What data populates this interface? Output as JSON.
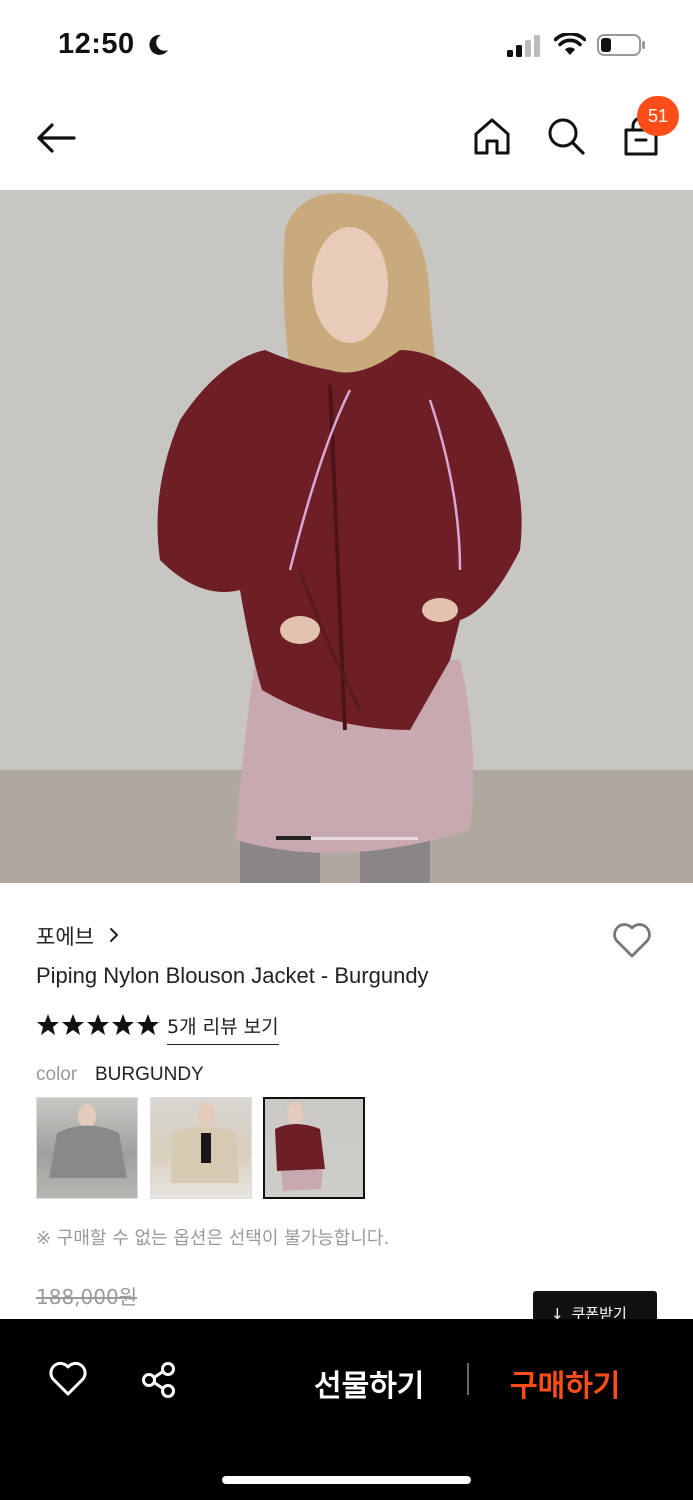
{
  "status_bar": {
    "time": "12:50",
    "icons": [
      "moon-icon",
      "signal-icon",
      "wifi-icon",
      "battery-icon"
    ]
  },
  "nav": {
    "icons": [
      "back-arrow-icon",
      "home-icon",
      "search-icon",
      "shopping-bag-icon"
    ],
    "cart_count": "51",
    "badge_color": "#ff4d1a"
  },
  "product": {
    "image_pager": {
      "total": 4,
      "active": 1
    },
    "brand": "포에브",
    "title": "Piping Nylon Blouson Jacket - Burgundy",
    "rating_stars": 5,
    "review_link": "5개 리뷰 보기",
    "color_label": "color",
    "color_value": "BURGUNDY",
    "color_options": [
      {
        "name": "grey",
        "selected": false
      },
      {
        "name": "beige",
        "selected": false
      },
      {
        "name": "burgundy",
        "selected": true
      }
    ],
    "notice": "※ 구매할 수 없는 옵션은 선택이 불가능합니다.",
    "original_price": "188,000원",
    "coupon_label": "쿠폰받기"
  },
  "bottom_bar": {
    "gift_label": "선물하기",
    "buy_label": "구매하기",
    "buy_color": "#ff4d1a",
    "icons": [
      "heart-icon",
      "share-icon"
    ]
  }
}
